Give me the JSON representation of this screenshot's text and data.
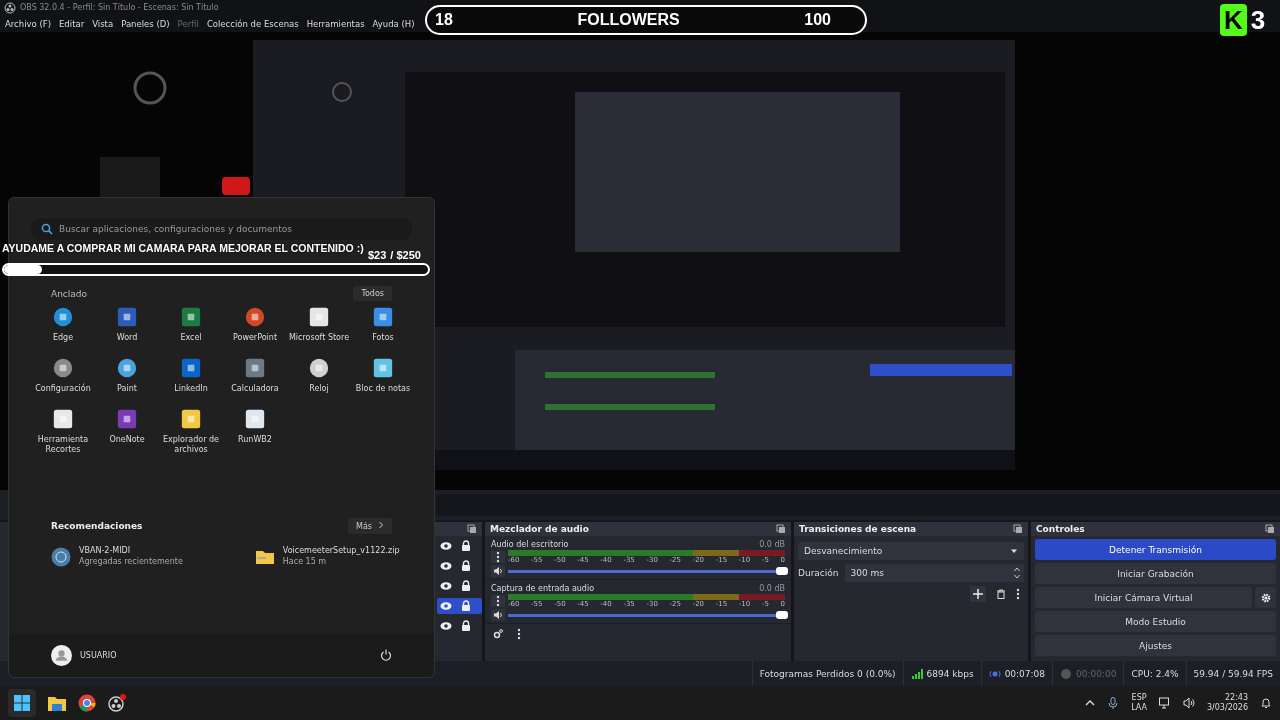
{
  "window": {
    "title": "OBS 32.0.4 - Perfil: Sin Título - Escenas: Sin Título"
  },
  "menu": [
    {
      "label": "Archivo (F)",
      "disabled": false
    },
    {
      "label": "Editar",
      "disabled": false
    },
    {
      "label": "Vista",
      "disabled": false
    },
    {
      "label": "Paneles (D)",
      "disabled": false
    },
    {
      "label": "Perfil",
      "disabled": true
    },
    {
      "label": "Colección de Escenas",
      "disabled": false
    },
    {
      "label": "Herramientas",
      "disabled": false
    },
    {
      "label": "Ayuda (H)",
      "disabled": false
    }
  ],
  "followers_overlay": {
    "current": "18",
    "label": "FOLLOWERS",
    "goal": "100"
  },
  "logo_overlay": {
    "letter": "K",
    "number": "3"
  },
  "donation_goal": {
    "text": "AYUDAME A COMPRAR MI CAMARA PARA MEJORAR EL CONTENIDO :)",
    "raised": "$23",
    "goal": "/ $250",
    "level": 0.09
  },
  "start_menu": {
    "search": {
      "placeholder": "Buscar aplicaciones, configuraciones y documentos"
    },
    "pinned_title": "Anclado",
    "all_button": "Todos",
    "pinned": [
      {
        "label": "Edge",
        "kind": "edge"
      },
      {
        "label": "Word",
        "kind": "word"
      },
      {
        "label": "Excel",
        "kind": "excel"
      },
      {
        "label": "PowerPoint",
        "kind": "powerpoint"
      },
      {
        "label": "Microsoft Store",
        "kind": "store"
      },
      {
        "label": "Fotos",
        "kind": "photos"
      },
      {
        "label": "Configuración",
        "kind": "settings"
      },
      {
        "label": "Paint",
        "kind": "paint"
      },
      {
        "label": "LinkedIn",
        "kind": "linkedin"
      },
      {
        "label": "Calculadora",
        "kind": "calculator"
      },
      {
        "label": "Reloj",
        "kind": "clock"
      },
      {
        "label": "Bloc de notas",
        "kind": "notepad"
      },
      {
        "label": "Herramienta Recortes",
        "kind": "snipping"
      },
      {
        "label": "OneNote",
        "kind": "onenote"
      },
      {
        "label": "Explorador de archivos",
        "kind": "folder"
      },
      {
        "label": "RunWB2",
        "kind": "runwb2"
      }
    ],
    "recommended_title": "Recomendaciones",
    "more_button": "Más",
    "recommended": [
      {
        "name": "VBAN-2-MIDI",
        "detail": "Agregadas recientemente",
        "kind": "app"
      },
      {
        "name": "VoicemeeterSetup_v1122.zip",
        "detail": "Hace 15 m",
        "kind": "zip"
      }
    ],
    "user": "USUARIO"
  },
  "sources": [
    {
      "visible": true,
      "locked": true,
      "selected": false
    },
    {
      "visible": true,
      "locked": true,
      "selected": false
    },
    {
      "visible": true,
      "locked": true,
      "selected": false
    },
    {
      "visible": true,
      "locked": true,
      "selected": true
    },
    {
      "visible": true,
      "locked": true,
      "selected": false
    }
  ],
  "mixer": {
    "title": "Mezclador de audio",
    "channels": [
      {
        "name": "Audio del escritorio",
        "reading": "0.0 dB",
        "level": 1,
        "scale": [
          "-60",
          "-55",
          "-50",
          "-45",
          "-40",
          "-35",
          "-30",
          "-25",
          "-20",
          "-15",
          "-10",
          "-5",
          "0"
        ]
      },
      {
        "name": "Captura de entrada audio",
        "reading": "0.0 dB",
        "level": 1,
        "scale": [
          "-60",
          "-55",
          "-50",
          "-45",
          "-40",
          "-35",
          "-30",
          "-25",
          "-20",
          "-15",
          "-10",
          "-5",
          "0"
        ]
      }
    ]
  },
  "transitions": {
    "title": "Transiciones de escena",
    "selected": "Desvanecimiento",
    "duration_label": "Duración",
    "duration": "300 ms"
  },
  "controls": {
    "title": "Controles",
    "buttons": [
      {
        "label": "Detener Transmisión",
        "active": true,
        "settings": false
      },
      {
        "label": "Iniciar Grabación",
        "active": false,
        "settings": false
      },
      {
        "label": "Iniciar Cámara Virtual",
        "active": false,
        "settings": true
      },
      {
        "label": "Modo Estudio",
        "active": false,
        "settings": false
      },
      {
        "label": "Ajustes",
        "active": false,
        "settings": false
      }
    ]
  },
  "status_bar": [
    {
      "kind": "text",
      "text": "Fotogramas Perdidos 0 (0.0%)"
    },
    {
      "kind": "bitrate",
      "text": "6894 kbps"
    },
    {
      "kind": "stream",
      "text": "00:07:08"
    },
    {
      "kind": "record",
      "text": "00:00:00"
    },
    {
      "kind": "text",
      "text": "CPU: 2.4%"
    },
    {
      "kind": "text",
      "text": "59.94 / 59.94 FPS"
    }
  ],
  "taskbar": {
    "apps": [
      {
        "kind": "start"
      },
      {
        "kind": "folder"
      },
      {
        "kind": "browser"
      },
      {
        "kind": "obs"
      }
    ],
    "language": "ESP",
    "layout": "LAA",
    "time": "22:43",
    "date": "3/03/2026"
  }
}
